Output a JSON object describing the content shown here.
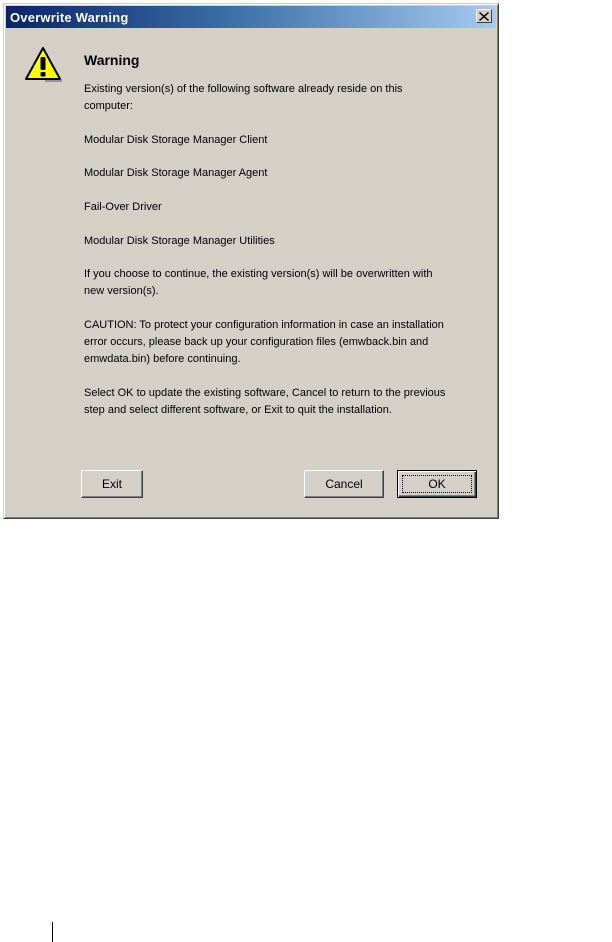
{
  "window": {
    "title": "Overwrite Warning",
    "close_label": "×"
  },
  "dialog": {
    "icon": "warning-triangle-icon",
    "heading": "Warning",
    "paragraphs": [
      "Existing version(s) of the following software already reside on this computer:",
      "Modular Disk Storage Manager Client",
      "Modular Disk Storage Manager Agent",
      "Fail-Over Driver",
      "Modular Disk Storage Manager Utilities",
      "If you choose to continue, the existing version(s) will be overwritten with new version(s).",
      "CAUTION: To protect your configuration information in case an installation error occurs, please back up your configuration files (emwback.bin and emwdata.bin) before continuing.",
      "Select OK to update the existing software, Cancel to return to the previous step and select different software, or Exit to quit the installation."
    ]
  },
  "buttons": {
    "exit": "Exit",
    "cancel": "Cancel",
    "ok": "OK"
  },
  "colors": {
    "titlebar_start": "#0a246a",
    "titlebar_end": "#a6caf0",
    "dialog_face": "#d4d0c8",
    "warning_yellow": "#ffff00"
  }
}
